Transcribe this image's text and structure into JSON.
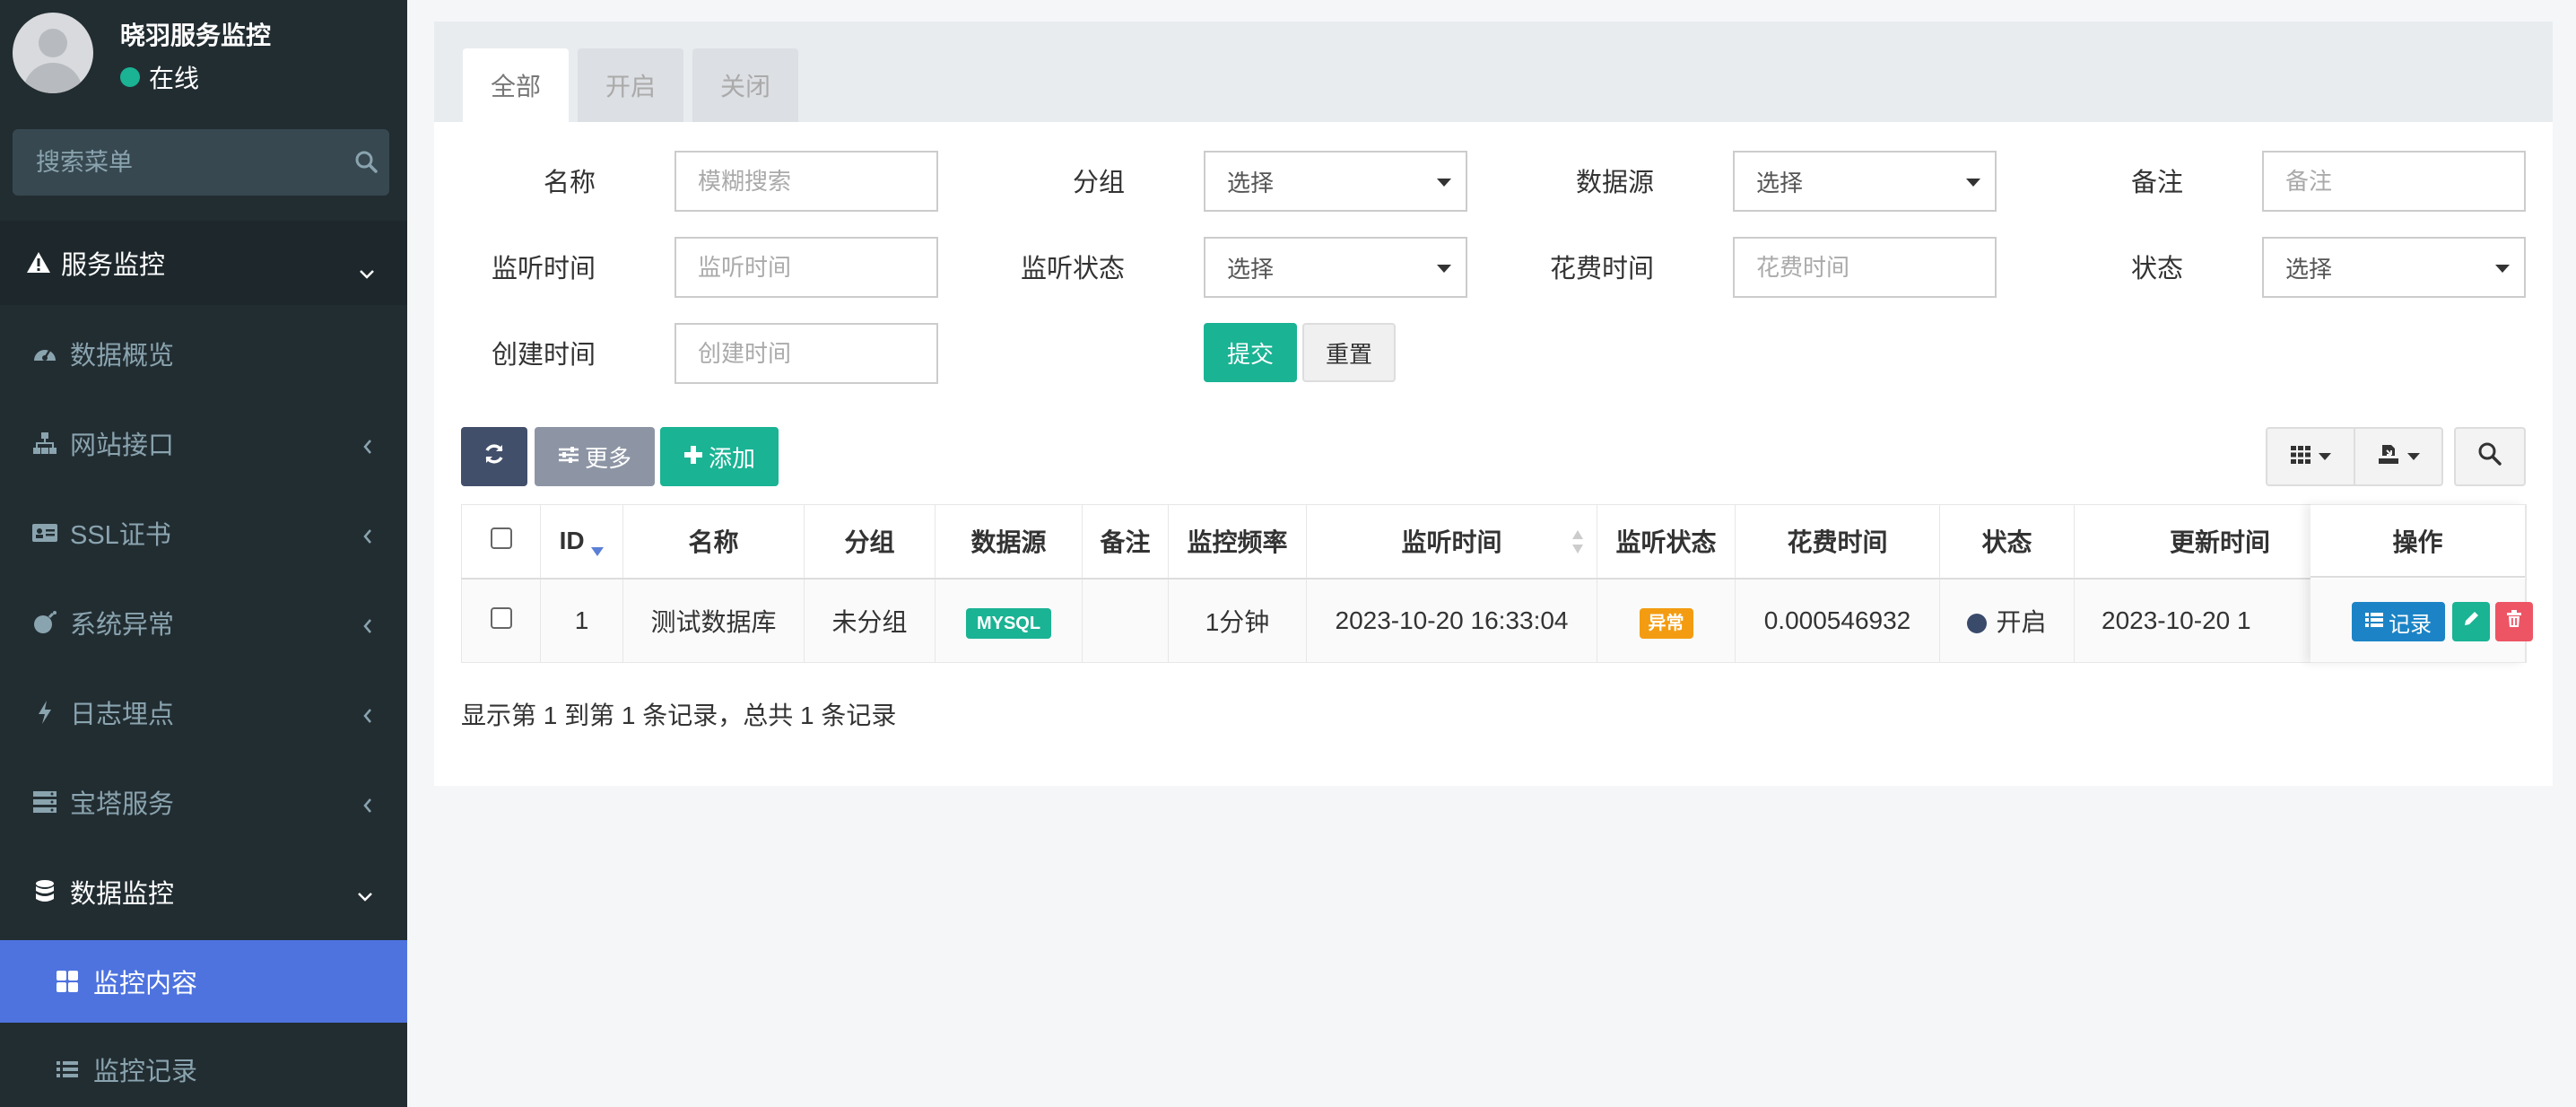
{
  "user": {
    "name": "晓羽服务监控",
    "status": "在线"
  },
  "sidebar": {
    "search_placeholder": "搜索菜单",
    "header": "服务监控",
    "items": [
      {
        "label": "数据概览"
      },
      {
        "label": "网站接口"
      },
      {
        "label": "SSL证书"
      },
      {
        "label": "系统异常"
      },
      {
        "label": "日志埋点"
      },
      {
        "label": "宝塔服务"
      },
      {
        "label": "数据监控"
      }
    ],
    "subitems": [
      {
        "label": "监控内容"
      },
      {
        "label": "监控记录"
      }
    ]
  },
  "tabs": [
    {
      "label": "全部"
    },
    {
      "label": "开启"
    },
    {
      "label": "关闭"
    }
  ],
  "filters": {
    "name_label": "名称",
    "name_placeholder": "模糊搜索",
    "group_label": "分组",
    "group_value": "选择",
    "source_label": "数据源",
    "source_value": "选择",
    "note_label": "备注",
    "note_placeholder": "备注",
    "listen_time_label": "监听时间",
    "listen_time_placeholder": "监听时间",
    "listen_status_label": "监听状态",
    "listen_status_value": "选择",
    "cost_time_label": "花费时间",
    "cost_time_placeholder": "花费时间",
    "status_label": "状态",
    "status_value": "选择",
    "create_time_label": "创建时间",
    "create_time_placeholder": "创建时间",
    "submit_label": "提交",
    "reset_label": "重置"
  },
  "toolbar": {
    "more_label": "更多",
    "add_label": "添加"
  },
  "table": {
    "columns": [
      "ID",
      "名称",
      "分组",
      "数据源",
      "备注",
      "监控频率",
      "监听时间",
      "监听状态",
      "花费时间",
      "状态",
      "更新时间",
      "操作"
    ],
    "rows": [
      {
        "id": "1",
        "name": "测试数据库",
        "group": "未分组",
        "source": "MYSQL",
        "note": "",
        "frequency": "1分钟",
        "listen_time": "2023-10-20 16:33:04",
        "listen_status": "异常",
        "cost_time": "0.000546932",
        "status": "开启",
        "update_time": "2023-10-20 1",
        "record_label": "记录"
      }
    ]
  },
  "pagination_info": "显示第 1 到第 1 条记录，总共 1 条记录",
  "colors": {
    "accent": "#1ab394",
    "sidebar": "#222d32",
    "active": "#4e73df",
    "warn": "#f39c12",
    "danger": "#ed5565",
    "info": "#1c84c6"
  }
}
